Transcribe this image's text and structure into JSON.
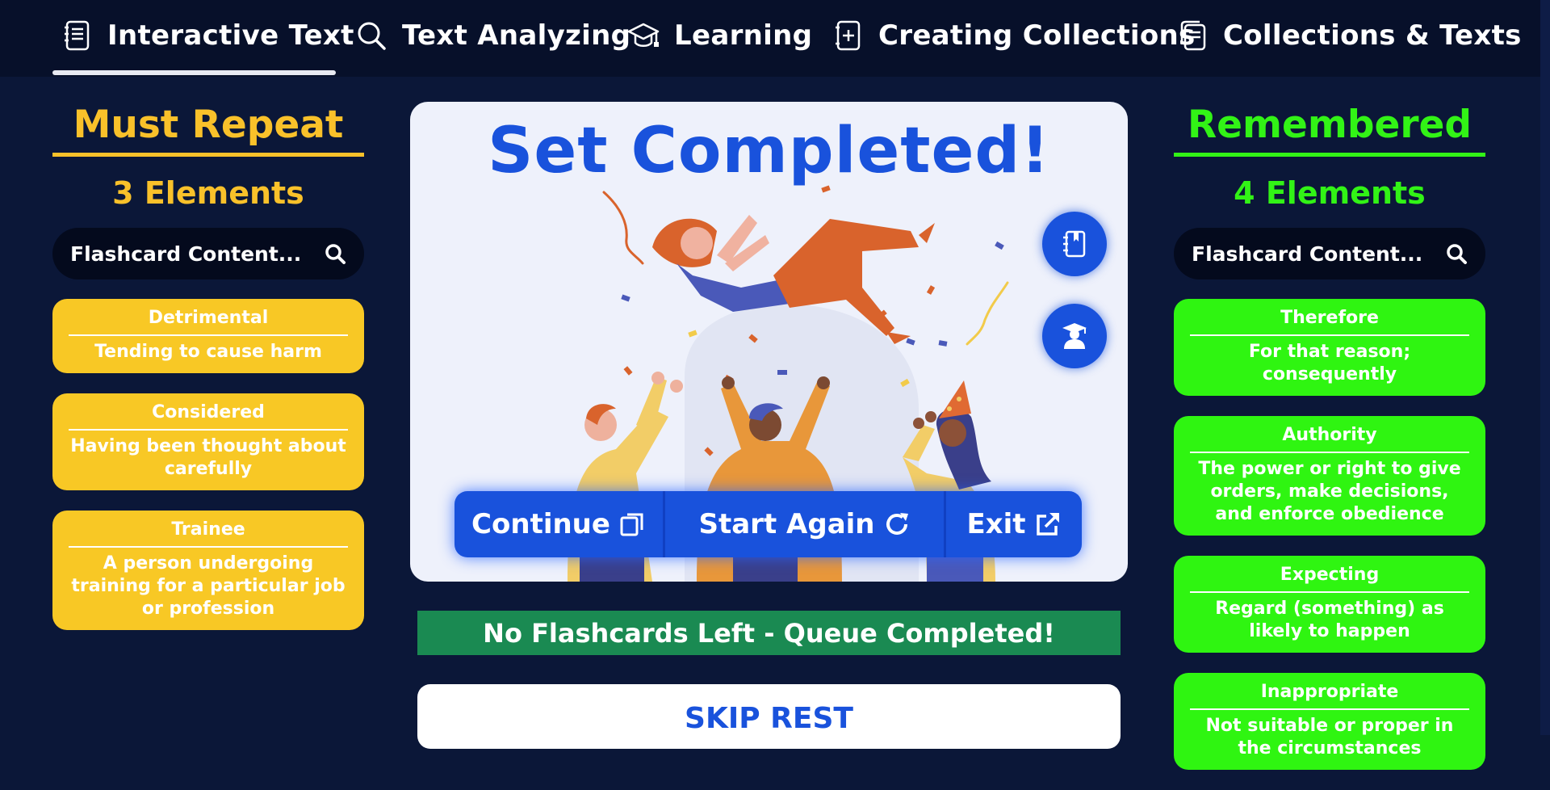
{
  "nav": {
    "items": [
      {
        "label": "Interactive Text",
        "icon": "document-icon",
        "active": true
      },
      {
        "label": "Text Analyzing",
        "icon": "search-icon"
      },
      {
        "label": "Learning",
        "icon": "graduation-cap-icon"
      },
      {
        "label": "Creating Collections",
        "icon": "add-document-icon"
      },
      {
        "label": "Collections & Texts",
        "icon": "documents-icon"
      }
    ]
  },
  "left": {
    "title": "Must Repeat",
    "count": "3 Elements",
    "search_placeholder": "Flashcard Content...",
    "cards": [
      {
        "word": "Detrimental",
        "definition": "Tending to cause harm"
      },
      {
        "word": "Considered",
        "definition": "Having been thought about carefully"
      },
      {
        "word": "Trainee",
        "definition": "A person undergoing training for a particular job or profession"
      }
    ]
  },
  "right": {
    "title": "Remembered",
    "count": "4 Elements",
    "search_placeholder": "Flashcard Content...",
    "cards": [
      {
        "word": "Therefore",
        "definition": "For that reason; consequently"
      },
      {
        "word": "Authority",
        "definition": "The power or right to give orders, make decisions, and enforce obedience"
      },
      {
        "word": "Expecting",
        "definition": "Regard (something) as likely to happen"
      },
      {
        "word": "Inappropriate",
        "definition": "Not suitable or proper in the circumstances"
      }
    ]
  },
  "center": {
    "title": "Set Completed!",
    "actions": {
      "continue": "Continue",
      "start_again": "Start Again",
      "exit": "Exit"
    }
  },
  "status": "No Flashcards Left - Queue Completed!",
  "skip": "SKIP REST",
  "colors": {
    "background": "#0b1738",
    "nav": "#07102a",
    "must_repeat": "#f8c825",
    "remembered": "#2ff511",
    "accent_blue": "#1952dc",
    "status_green": "#1a8a52"
  }
}
